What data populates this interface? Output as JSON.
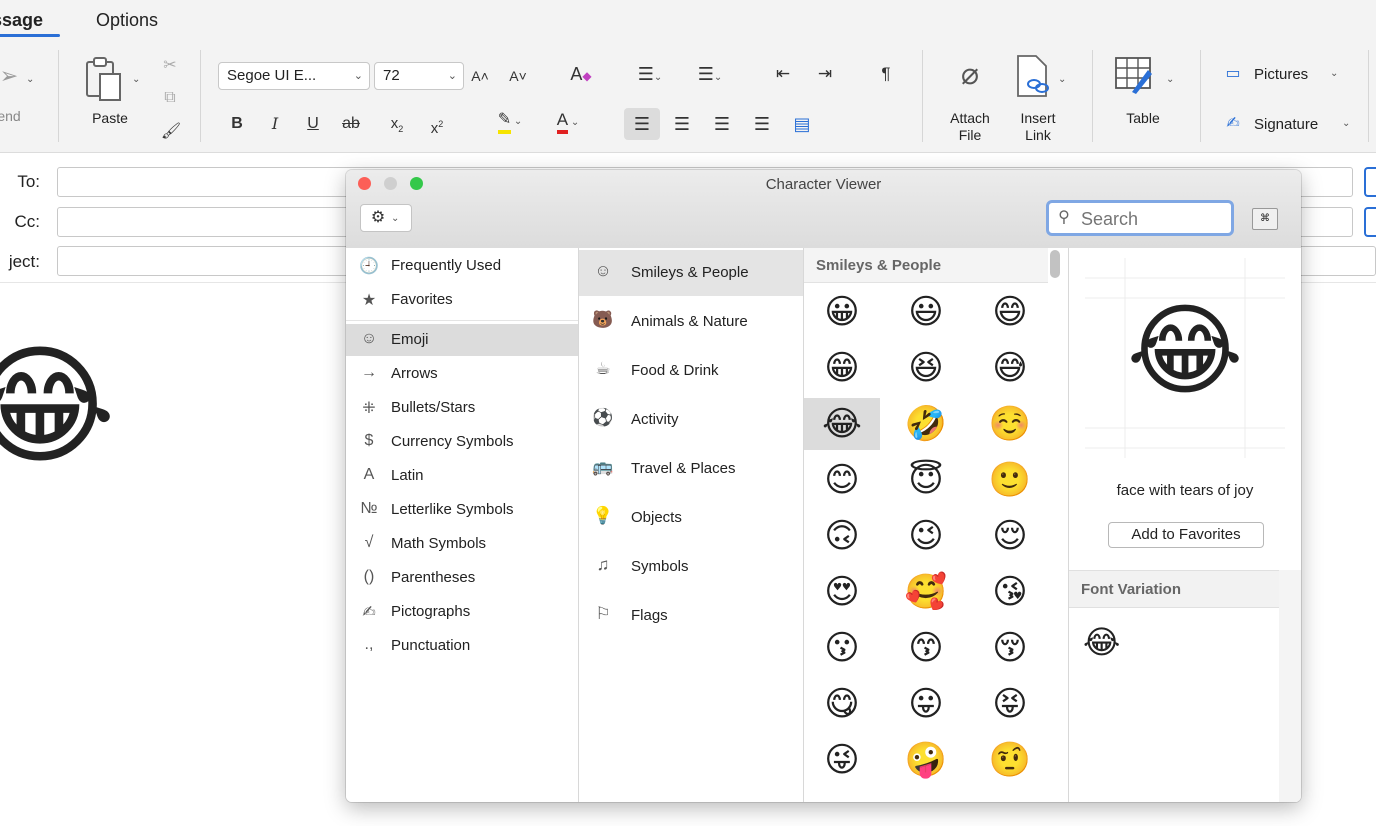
{
  "ribbon": {
    "tabs": [
      "ssage",
      "Options"
    ],
    "send_label": "end",
    "paste_label": "Paste",
    "font_name": "Segoe UI E...",
    "font_size": "72",
    "attach_label": "Attach\nFile",
    "insert_link_label": "Insert\nLink",
    "table_label": "Table",
    "pictures_label": "Pictures",
    "signature_label": "Signature",
    "icons": [
      "send-icon",
      "paste-icon",
      "cut-icon",
      "copy-icon",
      "format-painter-icon",
      "increase-font-icon",
      "decrease-font-icon",
      "clear-format-icon",
      "bullets-icon",
      "numbering-icon",
      "decrease-indent-icon",
      "increase-indent-icon",
      "pilcrow-icon",
      "bold-icon",
      "italic-icon",
      "underline-icon",
      "strikethrough-icon",
      "subscript-icon",
      "superscript-icon",
      "highlight-icon",
      "font-color-icon",
      "align-left-icon",
      "align-center-icon",
      "align-right-icon",
      "justify-icon",
      "distributed-icon",
      "paperclip-icon",
      "link-icon",
      "table-icon",
      "pictures-icon",
      "signature-icon"
    ]
  },
  "header": {
    "to_label": "To:",
    "cc_label": "Cc:",
    "subject_label": "ject:"
  },
  "body": {
    "emoji": "😂"
  },
  "viewer": {
    "title": "Character Viewer",
    "search_placeholder": "Search",
    "categories": [
      {
        "icon": "🕘",
        "label": "Frequently Used"
      },
      {
        "icon": "★",
        "label": "Favorites"
      },
      {
        "icon": "☺",
        "label": "Emoji"
      },
      {
        "icon": "→",
        "label": "Arrows"
      },
      {
        "icon": "⁜",
        "label": "Bullets/Stars"
      },
      {
        "icon": "$",
        "label": "Currency Symbols"
      },
      {
        "icon": "A",
        "label": "Latin"
      },
      {
        "icon": "№",
        "label": "Letterlike Symbols"
      },
      {
        "icon": "√",
        "label": "Math Symbols"
      },
      {
        "icon": "()",
        "label": "Parentheses"
      },
      {
        "icon": "✍",
        "label": "Pictographs"
      },
      {
        "icon": ".,",
        "label": "Punctuation"
      }
    ],
    "subcategories": [
      {
        "icon": "☺",
        "label": "Smileys & People"
      },
      {
        "icon": "🐻",
        "label": "Animals & Nature"
      },
      {
        "icon": "☕",
        "label": "Food & Drink"
      },
      {
        "icon": "⚽",
        "label": "Activity"
      },
      {
        "icon": "🚌",
        "label": "Travel & Places"
      },
      {
        "icon": "💡",
        "label": "Objects"
      },
      {
        "icon": "♫",
        "label": "Symbols"
      },
      {
        "icon": "⚐",
        "label": "Flags"
      }
    ],
    "grid_header": "Smileys & People",
    "emojis": [
      "😀",
      "😃",
      "😄",
      "😁",
      "😆",
      "😅",
      "😂",
      "🤣",
      "☺️",
      "😊",
      "😇",
      "🙂",
      "🙃",
      "😉",
      "😌",
      "😍",
      "🥰",
      "😘",
      "😗",
      "😙",
      "😚",
      "😋",
      "😛",
      "😝",
      "😜",
      "🤪",
      "🤨"
    ],
    "selected_index": 6,
    "preview_emoji": "😂",
    "preview_name": "face with tears of joy",
    "add_favorites_label": "Add to Favorites",
    "font_variation_label": "Font Variation",
    "variation_emoji": "😂"
  }
}
